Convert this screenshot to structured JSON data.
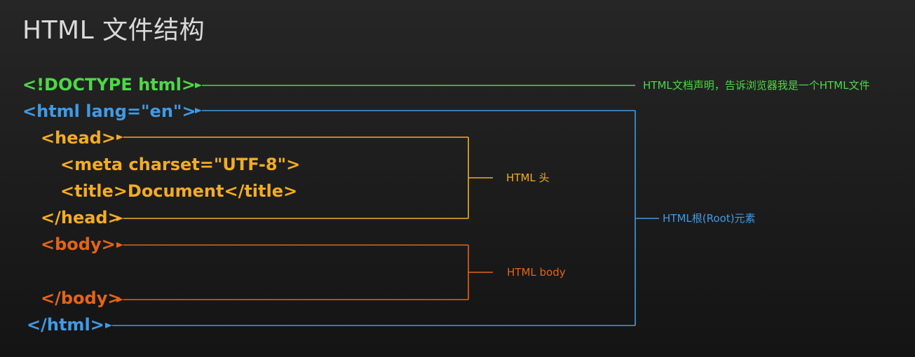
{
  "title": "HTML 文件结构",
  "code_lines": {
    "doctype": "<!DOCTYPE html>",
    "html_open": "<html lang=\"en\">",
    "head_open": "<head>",
    "meta": "<meta charset=\"UTF-8\">",
    "title_tag": "<title>Document</title>",
    "head_close": "</head>",
    "body_open": "<body>",
    "body_close": "</body>",
    "html_close": "</html>"
  },
  "annotations": {
    "doctype": "HTML文档声明，告诉浏览器我是一个HTML文件",
    "head": "HTML 头",
    "body": "HTML body",
    "root": "HTML根(Root)元素"
  },
  "colors": {
    "doctype": "#4cd946",
    "html": "#3f9be6",
    "head": "#f3ac25",
    "body": "#e46418"
  }
}
